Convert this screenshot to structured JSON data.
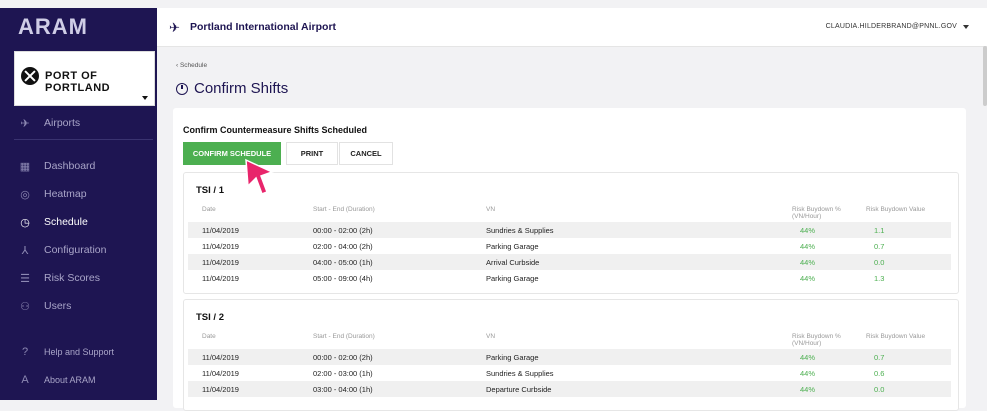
{
  "app": {
    "brand": "ARAM"
  },
  "org": {
    "name": "PORT OF PORTLAND"
  },
  "sidebar": {
    "airports": "Airports",
    "items": [
      {
        "label": "Dashboard",
        "icon": "dashboard-icon"
      },
      {
        "label": "Heatmap",
        "icon": "heatmap-icon"
      },
      {
        "label": "Schedule",
        "icon": "clock-icon",
        "active": true
      },
      {
        "label": "Configuration",
        "icon": "network-icon"
      },
      {
        "label": "Risk Scores",
        "icon": "sliders-icon"
      },
      {
        "label": "Users",
        "icon": "users-icon"
      }
    ],
    "help": "Help and Support",
    "about": "About ARAM"
  },
  "topbar": {
    "airport": "Portland International Airport",
    "user": "CLAUDIA.HILDERBRAND@PNNL.GOV"
  },
  "breadcrumb": "‹ Schedule",
  "page_title": "Confirm Shifts",
  "card": {
    "title": "Confirm Countermeasure Shifts Scheduled",
    "confirm_label": "CONFIRM SCHEDULE",
    "print_label": "PRINT",
    "cancel_label": "CANCEL"
  },
  "table_headers": {
    "date": "Date",
    "time": "Start - End (Duration)",
    "vn": "VN",
    "pct": "Risk Buydown %",
    "pct2": "(VN/Hour)",
    "val": "Risk Buydown Value"
  },
  "tsis": [
    {
      "name": "TSI / 1",
      "rows": [
        {
          "date": "11/04/2019",
          "time": "00:00 - 02:00 (2h)",
          "vn": "Sundries & Supplies",
          "pct": "44%",
          "val": "1.1"
        },
        {
          "date": "11/04/2019",
          "time": "02:00 - 04:00 (2h)",
          "vn": "Parking Garage",
          "pct": "44%",
          "val": "0.7"
        },
        {
          "date": "11/04/2019",
          "time": "04:00 - 05:00 (1h)",
          "vn": "Arrival Curbside",
          "pct": "44%",
          "val": "0.0"
        },
        {
          "date": "11/04/2019",
          "time": "05:00 - 09:00 (4h)",
          "vn": "Parking Garage",
          "pct": "44%",
          "val": "1.3"
        }
      ]
    },
    {
      "name": "TSI / 2",
      "rows": [
        {
          "date": "11/04/2019",
          "time": "00:00 - 02:00 (2h)",
          "vn": "Parking Garage",
          "pct": "44%",
          "val": "0.7"
        },
        {
          "date": "11/04/2019",
          "time": "02:00 - 03:00 (1h)",
          "vn": "Sundries & Supplies",
          "pct": "44%",
          "val": "0.6"
        },
        {
          "date": "11/04/2019",
          "time": "03:00 - 04:00 (1h)",
          "vn": "Departure Curbside",
          "pct": "44%",
          "val": "0.0"
        }
      ]
    }
  ],
  "colors": {
    "sidebar": "#1e1552",
    "accent": "#4caf50",
    "cursor": "#e8256b"
  }
}
